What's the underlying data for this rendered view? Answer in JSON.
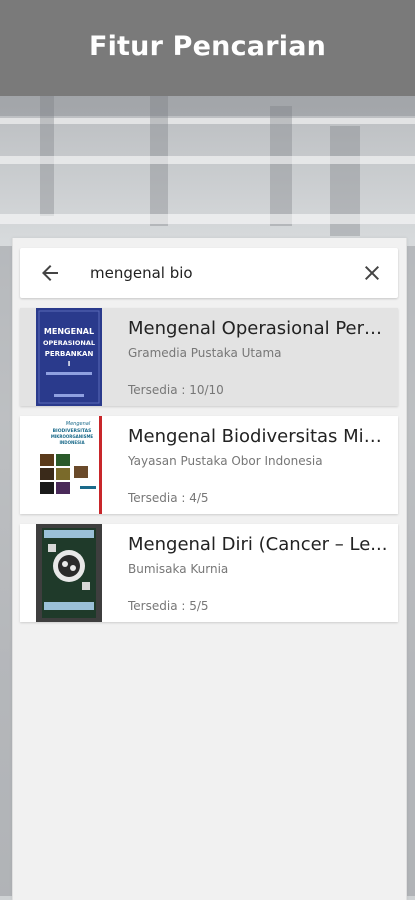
{
  "header": {
    "title": "Fitur Pencarian"
  },
  "search": {
    "query": "mengenal bio",
    "back_icon": "arrow-left-icon",
    "clear_icon": "close-icon"
  },
  "results": [
    {
      "title": "Mengenal Operasional Perb...",
      "publisher": "Gramedia Pustaka Utama",
      "availability": "Tersedia : 10/10",
      "cover": {
        "line1": "MENGENAL",
        "line2": "OPERASIONAL",
        "line3": "PERBANKAN",
        "line4": "I",
        "color": "#2a3a8c"
      }
    },
    {
      "title": " Mengenal Biodiversitas Mik...",
      "publisher": "Yayasan Pustaka Obor Indonesia",
      "availability": "Tersedia : 4/5",
      "cover": {
        "line1": "Mengenal",
        "line2": "BIODIVERSITAS",
        "line3": "MIKROORGANISME",
        "line4": "INDONESIA",
        "color": "#ffffff"
      }
    },
    {
      "title": "Mengenal Diri (Cancer – Le...",
      "publisher": "Bumisaka Kurnia",
      "availability": "Tersedia : 5/5",
      "cover": {
        "color": "#1f3a2a"
      }
    }
  ],
  "colors": {
    "banner": "#7a7a7a",
    "selected_card": "#e3e3e3"
  }
}
